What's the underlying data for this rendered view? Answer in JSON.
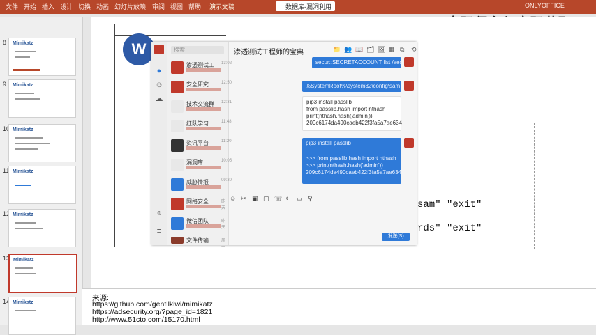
{
  "titlebar": {
    "tabs": [
      "文件",
      "开始",
      "插入",
      "设计",
      "切换",
      "动画",
      "幻灯片放映",
      "审阅",
      "视图",
      "帮助"
    ],
    "document": "演示文稿",
    "window_tab": "数据库-漏洞利用",
    "user": "ONLYOFFICE",
    "overlay_title": "密码保存与密码获取"
  },
  "thumbnails": [
    {
      "num": "8",
      "title": "Mimikatz"
    },
    {
      "num": "9",
      "title": "Mimikatz"
    },
    {
      "num": "10",
      "title": "Mimikatz"
    },
    {
      "num": "11",
      "title": "Mimikatz"
    },
    {
      "num": "12",
      "title": "Mimikatz"
    },
    {
      "num": "13",
      "title": "Mimikatz"
    },
    {
      "num": "14",
      "title": "Mimikatz"
    }
  ],
  "slide": {
    "logo_letter": "W",
    "snippet1": "sam\" \"exit\"",
    "snippet2": "rds\" \"exit\""
  },
  "chat": {
    "search_placeholder": "搜索",
    "contacts": [
      {
        "name": "渗透测试工",
        "time": "13:02"
      },
      {
        "name": "安全研究",
        "time": "12:50"
      },
      {
        "name": "技术交流群",
        "time": "12:31"
      },
      {
        "name": "红队学习",
        "time": "11:48"
      },
      {
        "name": "资讯平台",
        "time": "11:20"
      },
      {
        "name": "漏洞库",
        "time": "10:05"
      },
      {
        "name": "威胁情报",
        "time": "09:30"
      },
      {
        "name": "网络安全",
        "time": "昨天"
      },
      {
        "name": "微信团队",
        "time": "昨天"
      },
      {
        "name": "文件传输",
        "time": "周一"
      }
    ],
    "title": "渗透测试工程师的宝典",
    "toolbar_icons": [
      "📁",
      "👥",
      "📖",
      "🗂",
      "🖼",
      "▦",
      "⧉",
      "⟲"
    ],
    "messages": {
      "m1": "secur::SECRETACCOUNT list /aesl",
      "m2": "%SystemRoot%\\system32\\config\\sam",
      "m3": [
        "pip3 install passlib",
        "from passlib.hash import nthash",
        "print(nthash.hash('admin'))",
        "209c6174da490caeb422f3fa5a7ae634"
      ],
      "m4": [
        "pip3 install passlib",
        ">>> from passlib.hash import nthash",
        ">>> print(nthash.hash('admin'))",
        "209c6174da490caeb422f3fa5a7ae634"
      ]
    },
    "input_tools": [
      "☺",
      "✂",
      "▣",
      "▢",
      "☏",
      "⌖",
      "▭",
      "⚲"
    ],
    "send_label": "发送(S)"
  },
  "notes": {
    "label": "来源:",
    "links": [
      "https://github.com/gentilkiwi/mimikatz",
      "https://adsecurity.org/?page_id=1821",
      "http://www.51cto.com/15170.html"
    ]
  }
}
